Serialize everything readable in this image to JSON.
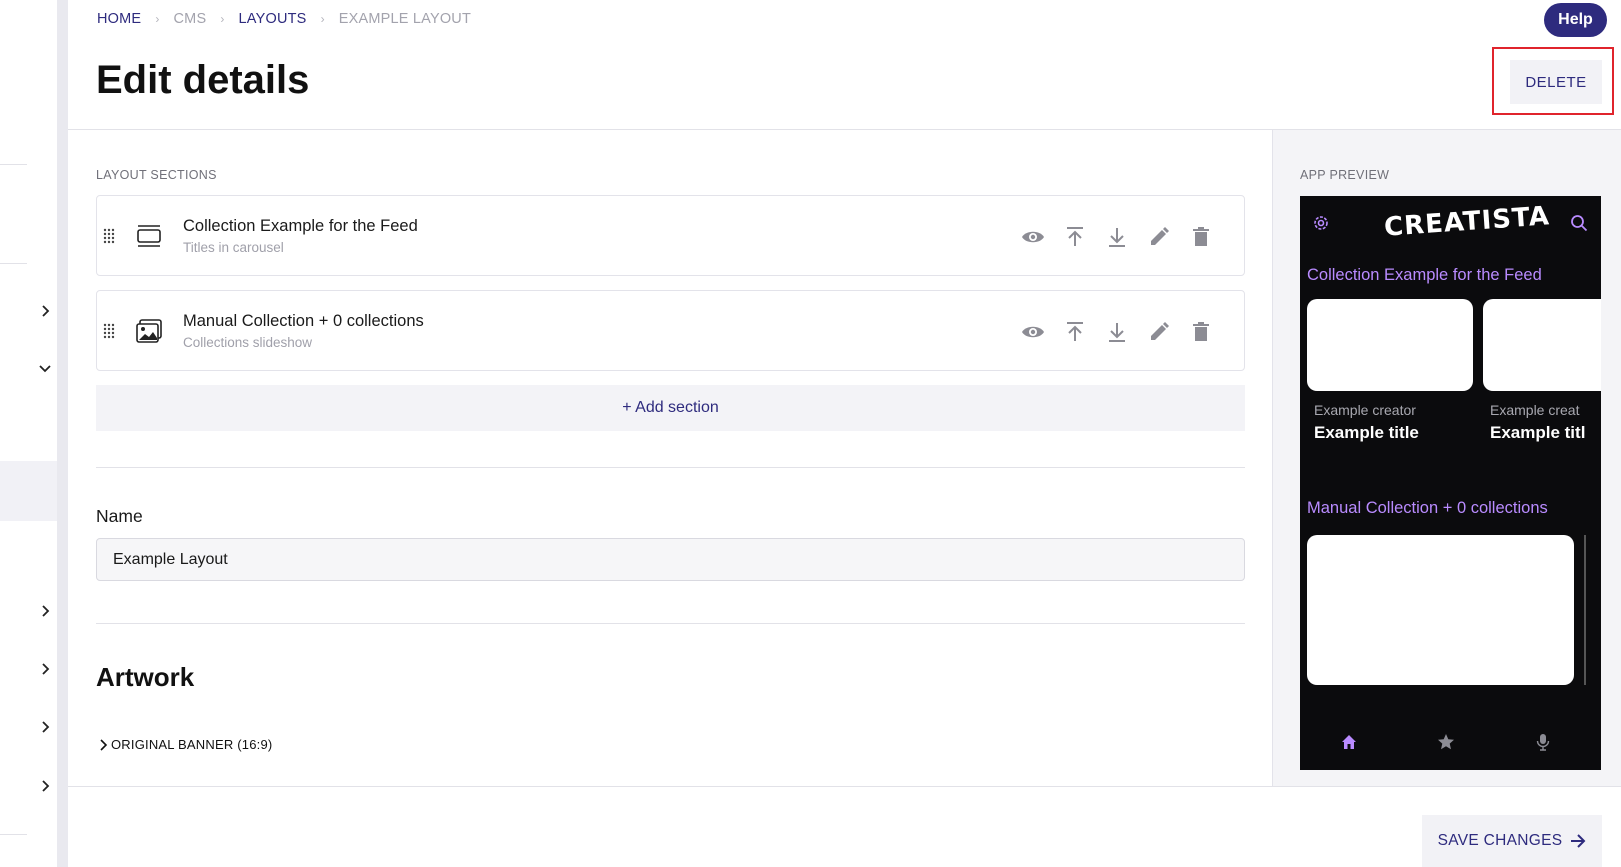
{
  "breadcrumb": {
    "items": [
      {
        "label": "HOME",
        "link": true
      },
      {
        "label": "CMS",
        "link": false
      },
      {
        "label": "LAYOUTS",
        "link": true
      },
      {
        "label": "EXAMPLE LAYOUT",
        "link": false
      }
    ]
  },
  "header": {
    "help_label": "Help",
    "title": "Edit details",
    "delete_label": "DELETE"
  },
  "layout_sections": {
    "label": "LAYOUT SECTIONS",
    "items": [
      {
        "title": "Collection Example for the Feed",
        "subtitle": "Titles in carousel",
        "icon": "carousel-icon"
      },
      {
        "title": "Manual Collection + 0 collections",
        "subtitle": "Collections slideshow",
        "icon": "image-icon"
      }
    ],
    "actions": [
      "eye-icon",
      "move-to-top-icon",
      "download-icon",
      "pencil-icon",
      "trash-icon"
    ],
    "add_label": "+ Add section"
  },
  "name_field": {
    "label": "Name",
    "value": "Example Layout"
  },
  "artwork": {
    "heading": "Artwork",
    "banner_label": "ORIGINAL BANNER (16:9)"
  },
  "preview": {
    "label": "APP PREVIEW",
    "logo": "CREATISTA",
    "sections": [
      {
        "title": "Collection Example for the Feed",
        "cards": [
          {
            "creator": "Example creator",
            "title": "Example title"
          },
          {
            "creator": "Example creat",
            "title": "Example titl"
          }
        ]
      },
      {
        "title": "Manual Collection + 0 collections"
      }
    ],
    "nav_icons": [
      "home-icon",
      "star-icon",
      "microphone-icon"
    ],
    "accent_color": "#b98bff"
  },
  "footer": {
    "save_label": "SAVE CHANGES"
  },
  "colors": {
    "brand": "#2e2b7e",
    "highlight": "#e0242c"
  }
}
